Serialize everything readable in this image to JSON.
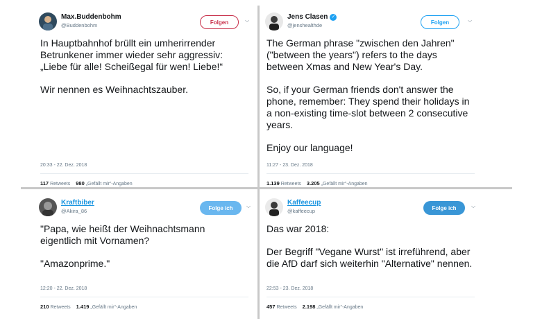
{
  "tweets": [
    {
      "name": "Max.Buddenbohm",
      "handle": "@Buddenbohm",
      "follow": "Folgen",
      "paragraphs": [
        "In Hauptbahnhof brüllt ein umherirrender Betrunkener immer wieder sehr aggressiv: „Liebe für alle! Scheißegal für wen! Liebe!“",
        "Wir nennen es Weihnachtszauber."
      ],
      "time": "20:33 - 22. Dez. 2018",
      "retweets": "117",
      "retweets_label": "Retweets",
      "likes": "980",
      "likes_label": "„Gefällt mir“-Angaben"
    },
    {
      "name": "Jens Clasen",
      "handle": "@jenshealthde",
      "follow": "Folgen",
      "paragraphs": [
        "The German phrase \"zwischen den Jahren\" (\"between the years\") refers to the days between Xmas and New Year's Day.",
        "So, if your German friends don't answer the phone, remember: They spend their holidays in a non-existing time-slot between 2 consecutive years.",
        "Enjoy our language!"
      ],
      "time": "11:27 - 23. Dez. 2018",
      "retweets": "1.139",
      "retweets_label": "Retweets",
      "likes": "3.205",
      "likes_label": "„Gefällt mir“-Angaben"
    },
    {
      "name": "Kraftbiber",
      "handle": "@Akira_86",
      "follow": "Folge ich",
      "paragraphs": [
        "\"Papa, wie heißt der Weihnachtsmann eigentlich mit Vornamen?",
        "\"Amazonprime.\""
      ],
      "time": "12:20 - 22. Dez. 2018",
      "retweets": "210",
      "retweets_label": "Retweets",
      "likes": "1.419",
      "likes_label": "„Gefällt mir“-Angaben"
    },
    {
      "name": "Kaffeecup",
      "handle": "@kaffeecup",
      "follow": "Folge ich",
      "paragraphs": [
        "Das war 2018:",
        "Der Begriff \"Vegane Wurst\" ist irreführend, aber die AfD darf sich weiterhin \"Alternative\" nennen."
      ],
      "time": "22:53 - 23. Dez. 2018",
      "retweets": "457",
      "retweets_label": "Retweets",
      "likes": "2.198",
      "likes_label": "„Gefällt mir“-Angaben"
    }
  ],
  "icons": {
    "verified": "verified-badge-icon",
    "chevron": "chevron-down-icon"
  },
  "colors": {
    "link_blue": "#1da1f2",
    "follow_red": "#c8304a",
    "muted": "#657786",
    "divider": "#c8c8c8"
  }
}
